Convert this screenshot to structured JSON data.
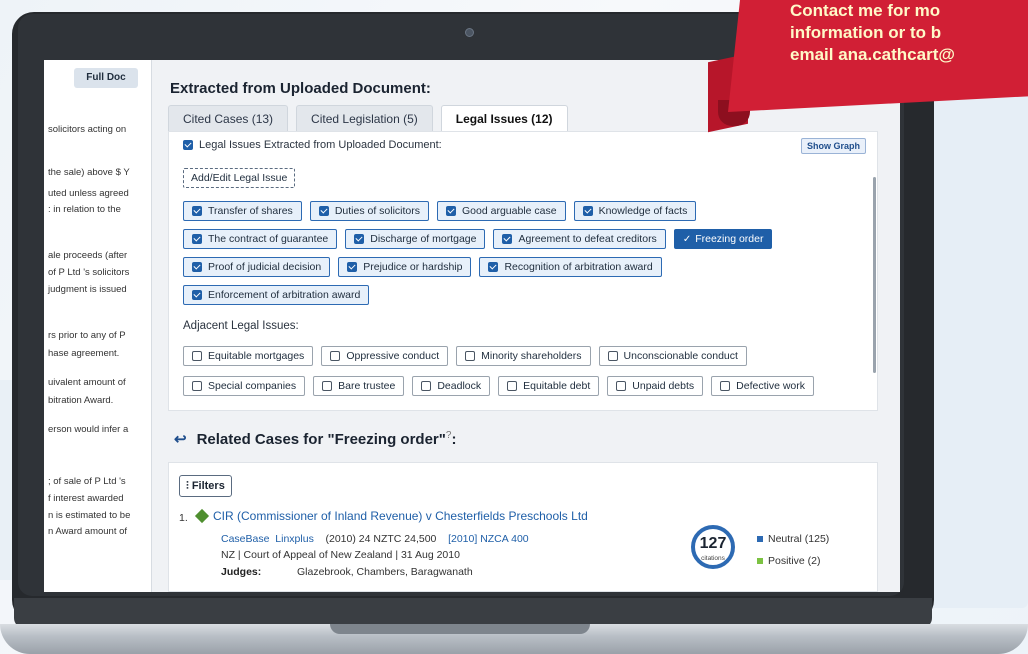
{
  "doc_pane": {
    "full_doc_label": "Full Doc",
    "lines": [
      "solicitors acting on",
      "the sale) above $ Y",
      "uted unless agreed",
      ": in relation to the",
      "ale proceeds (after",
      "of P Ltd 's solicitors",
      "judgment is issued",
      "rs prior to any of P",
      "hase agreement.",
      "uivalent amount of",
      "bitration Award.",
      "erson would infer a",
      "; of sale of P Ltd 's",
      "f interest awarded",
      "n is estimated to be",
      "n Award amount of"
    ]
  },
  "extracted": {
    "heading": "Extracted from Uploaded Document:",
    "tabs": [
      {
        "label": "Cited Cases (13)",
        "active": false
      },
      {
        "label": "Cited Legislation (5)",
        "active": false
      },
      {
        "label": "Legal Issues (12)",
        "active": true
      }
    ],
    "extracted_checkbox_label": "Legal Issues Extracted from Uploaded Document:",
    "show_graph_label": "Show Graph",
    "add_edit_label": "Add/Edit Legal Issue",
    "selected_rows": [
      [
        "Transfer of shares",
        "Duties of solicitors",
        "Good arguable case",
        "Knowledge of facts"
      ],
      [
        "The contract of guarantee",
        "Discharge of mortgage",
        "Agreement to defeat creditors",
        "Freezing order"
      ],
      [
        "Proof of judicial decision",
        "Prejudice or hardship",
        "Recognition of arbitration award"
      ],
      [
        "Enforcement of arbitration award"
      ]
    ],
    "active_issue": "Freezing order",
    "adjacent_label": "Adjacent Legal Issues:",
    "adjacent_rows": [
      [
        "Equitable mortgages",
        "Oppressive conduct",
        "Minority shareholders",
        "Unconscionable conduct"
      ],
      [
        "Special companies",
        "Bare trustee",
        "Deadlock",
        "Equitable debt",
        "Unpaid debts",
        "Defective work"
      ]
    ]
  },
  "related": {
    "back_icon": "return-arrow-icon",
    "heading": "Related Cases for \"Freezing order\"",
    "help_glyph": "?",
    "colon": ":",
    "filters_label": "Filters",
    "filters_icon": "sliders-icon",
    "case": {
      "number": "1.",
      "title": "CIR (Commissioner of Inland Revenue) v Chesterfields Preschools Ltd",
      "source1": "CaseBase",
      "source2": "Linxplus",
      "citation": "(2010) 24 NZTC 24,500",
      "neutral_citation": "[2010] NZCA 400",
      "court": "NZ | Court of Appeal of New Zealand | 31 Aug 2010",
      "judges_key": "Judges:",
      "judges": "Glazebrook, Chambers, Baragwanath",
      "citations_count": "127",
      "citations_label": "citations",
      "legend": [
        {
          "label": "Neutral (125)",
          "color": "#2d6ab3"
        },
        {
          "label": "Positive (2)",
          "color": "#7cc242"
        }
      ]
    }
  },
  "ribbon": {
    "lines": [
      "Contact me for mo",
      "information or to b",
      "email ana.cathcart@"
    ],
    "color": "#d11f35"
  }
}
